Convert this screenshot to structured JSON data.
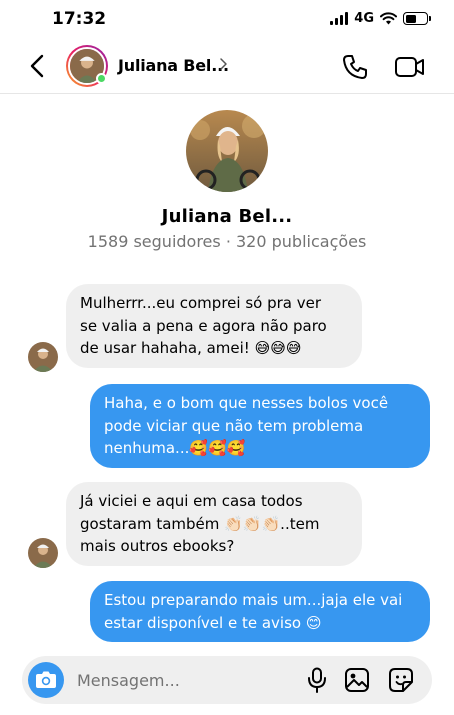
{
  "status_bar": {
    "time": "17:32",
    "network": "4G",
    "battery_level": 0.5
  },
  "header": {
    "name": "Juliana Bel..."
  },
  "profile": {
    "name": "Juliana Bel...",
    "stats": "1589 seguidores · 320 publicações"
  },
  "messages": [
    {
      "direction": "incoming",
      "lines": [
        "Mulherrr...eu comprei só pra ver",
        "se valia a pena e agora não paro",
        "de usar hahaha, amei! 😅😅😅"
      ]
    },
    {
      "direction": "outgoing",
      "lines": [
        "Haha, e o bom que nesses bolos você",
        "pode viciar que não tem problema",
        "nenhuma...🥰🥰🥰"
      ]
    },
    {
      "direction": "incoming",
      "lines": [
        "Já viciei e aqui em casa todos",
        "gostaram também 👏🏻👏🏻👏🏻..tem",
        "mais outros ebooks?"
      ]
    },
    {
      "direction": "outgoing",
      "lines": [
        "Estou preparando mais um...jaja ele vai",
        "estar disponível e te aviso 😊"
      ]
    }
  ],
  "composer": {
    "placeholder": "Mensagem..."
  },
  "colors": {
    "outgoing_bubble": "#3797f0",
    "incoming_bubble": "#efefef",
    "online": "#4cd964",
    "muted_text": "#737373"
  }
}
